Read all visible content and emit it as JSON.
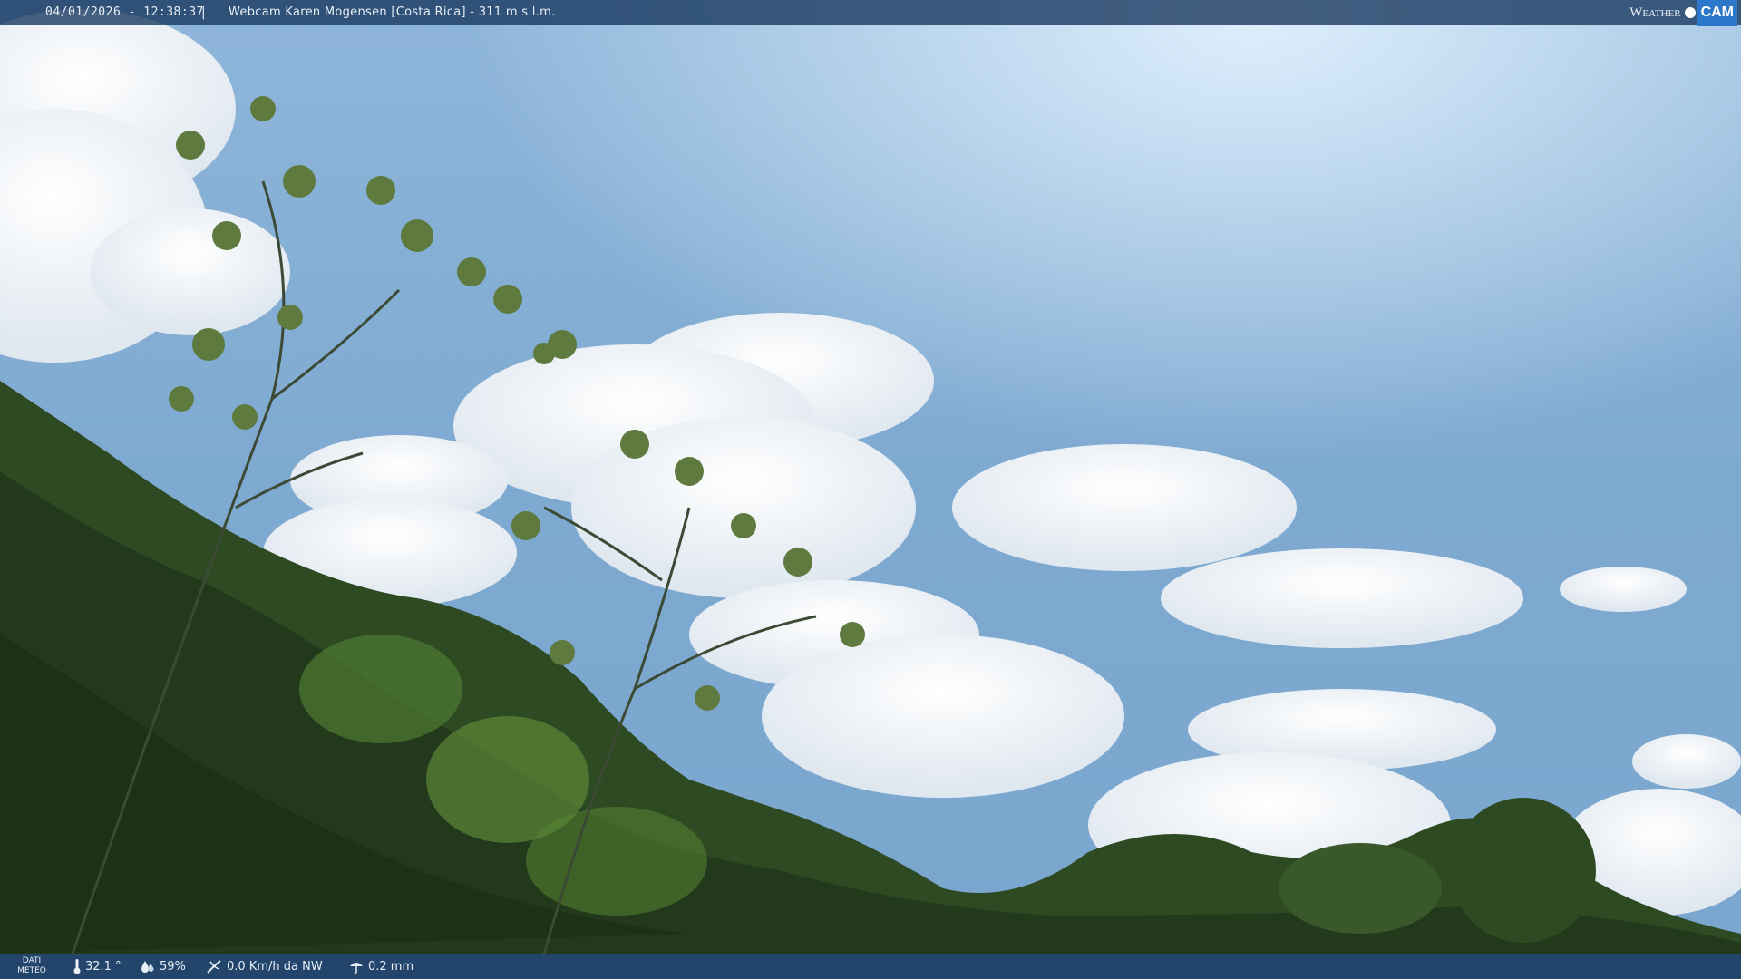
{
  "overlay": {
    "timestamp": "04/01/2026 - 12:38:37",
    "separator": "|",
    "title": "Webcam Karen Mogensen [Costa Rica]  - 311 m s.l.m.",
    "logo_weather": "Weather",
    "logo_cam": "CAM"
  },
  "meteo": {
    "label_line1": "DATI",
    "label_line2": "METEO",
    "temperature": "32.1 °",
    "humidity": "59%",
    "wind": "0.0 Km/h da NW",
    "rain": "0.2 mm",
    "icons": [
      "thermometer-icon",
      "humidity-icon",
      "wind-icon",
      "rain-icon"
    ]
  },
  "colors": {
    "sky_top": "#a9cdea",
    "sky_bottom": "#6f9ec8",
    "foliage": "#2f4a22",
    "bar": "#14345c"
  }
}
